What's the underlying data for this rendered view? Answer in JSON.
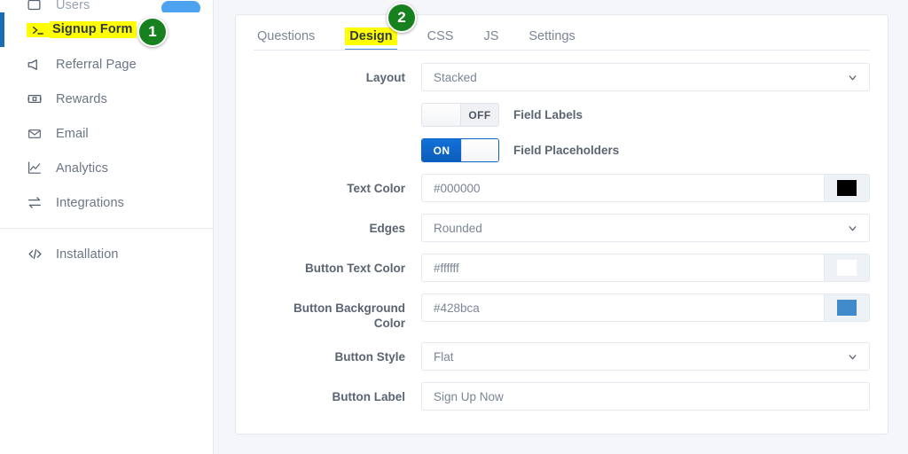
{
  "sidebar": {
    "items": [
      {
        "label": "Users",
        "icon": "users-icon",
        "partial": true,
        "badge": true
      },
      {
        "label": "Signup Form",
        "icon": "terminal-prompt-icon",
        "active": true
      },
      {
        "label": "Referral Page",
        "icon": "megaphone-icon"
      },
      {
        "label": "Rewards",
        "icon": "gift-box-icon"
      },
      {
        "label": "Email",
        "icon": "envelope-icon"
      },
      {
        "label": "Analytics",
        "icon": "line-chart-icon"
      },
      {
        "label": "Integrations",
        "icon": "transfer-arrows-icon"
      },
      {
        "label": "Installation",
        "icon": "code-brackets-icon"
      }
    ]
  },
  "callouts": [
    {
      "number": "1"
    },
    {
      "number": "2"
    }
  ],
  "main": {
    "tabs": [
      {
        "label": "Questions",
        "active": false
      },
      {
        "label": "Design",
        "active": true
      },
      {
        "label": "CSS",
        "active": false
      },
      {
        "label": "JS",
        "active": false
      },
      {
        "label": "Settings",
        "active": false
      }
    ],
    "fields": {
      "layout": {
        "label": "Layout",
        "value": "Stacked",
        "type": "select"
      },
      "field_labels": {
        "label": "Field Labels",
        "state": "OFF",
        "type": "toggle"
      },
      "field_placeholders": {
        "label": "Field Placeholders",
        "state": "ON",
        "type": "toggle"
      },
      "text_color": {
        "label": "Text Color",
        "value": "#000000",
        "swatch": "#000000",
        "type": "color"
      },
      "edges": {
        "label": "Edges",
        "value": "Rounded",
        "type": "select"
      },
      "button_text_color": {
        "label": "Button Text Color",
        "value": "#ffffff",
        "swatch": "#ffffff",
        "type": "color"
      },
      "button_background_color": {
        "label": "Button Background\nColor",
        "label_line1": "Button Background",
        "label_line2": "Color",
        "value": "#428bca",
        "swatch": "#428bca",
        "type": "color"
      },
      "button_style": {
        "label": "Button Style",
        "value": "Flat",
        "type": "select"
      },
      "button_label": {
        "label": "Button Label",
        "value": "Sign Up Now",
        "type": "text"
      }
    }
  },
  "colors": {
    "accent_blue": "#1a6cb5",
    "toggle_on_blue": "#0b63c5",
    "highlight_yellow": "#ffff00",
    "callout_green": "#17801f",
    "swatch_blue": "#428bca"
  }
}
